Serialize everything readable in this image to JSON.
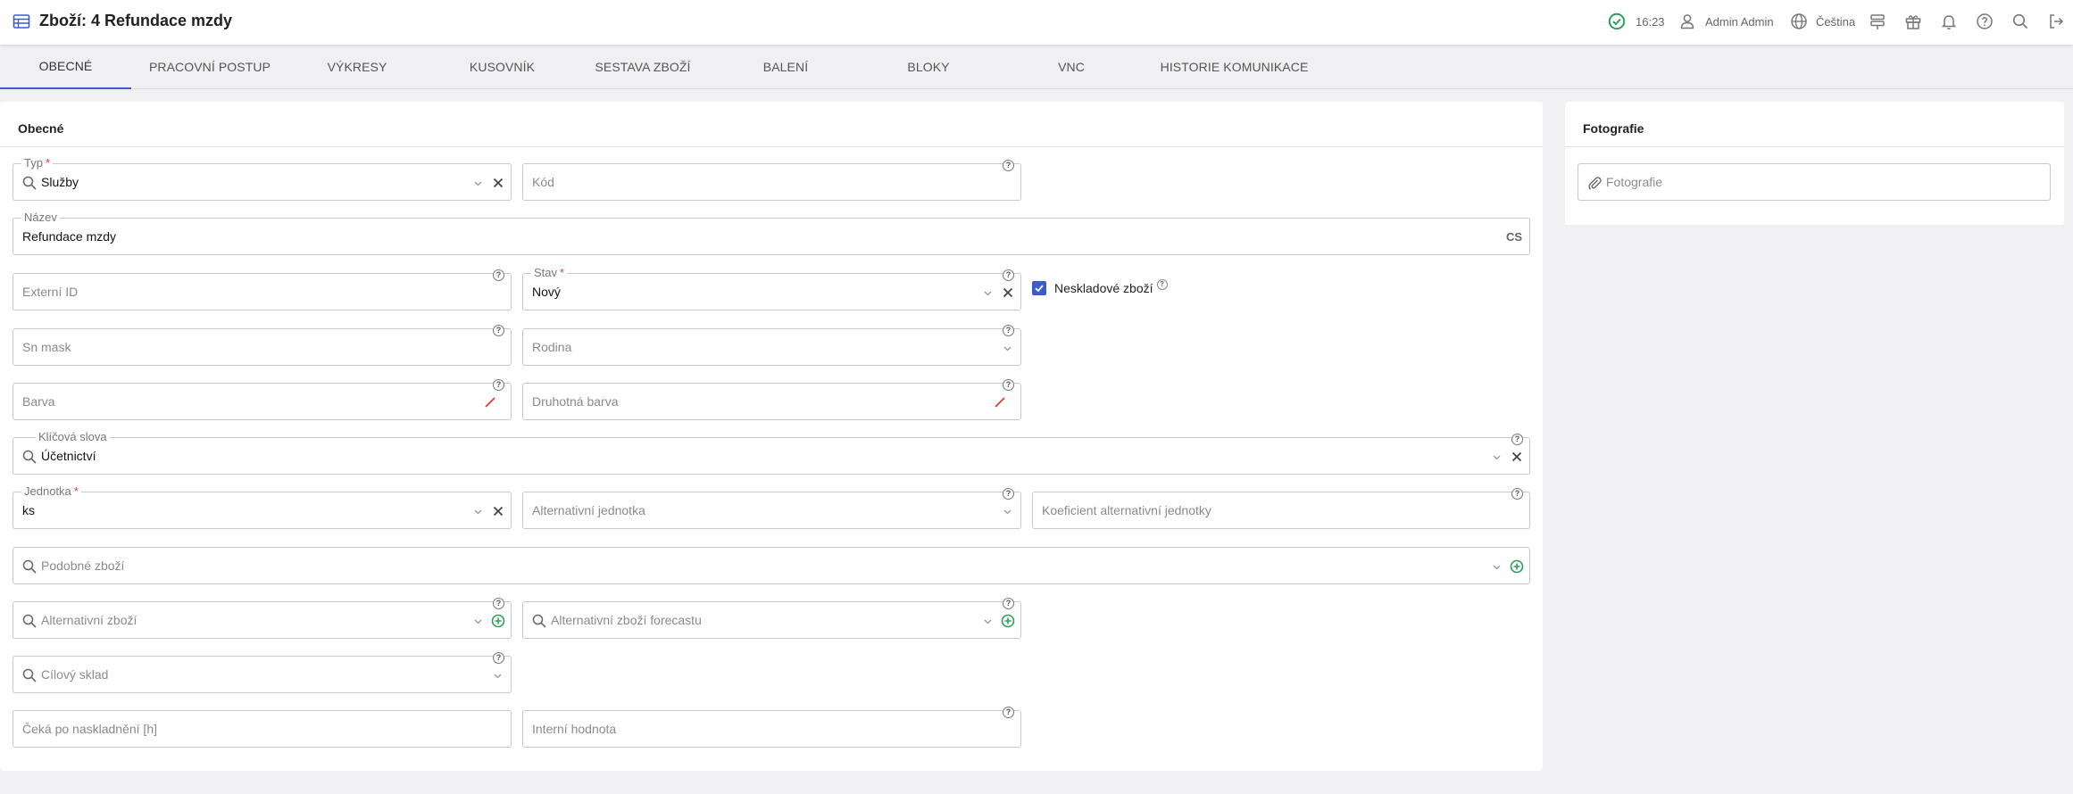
{
  "header": {
    "title": "Zboží: 4 Refundace mzdy",
    "time": "16:23",
    "user": "Admin Admin",
    "language": "Čeština"
  },
  "tabs": [
    {
      "label": "Obecné",
      "active": true
    },
    {
      "label": "Pracovní postup"
    },
    {
      "label": "Výkresy"
    },
    {
      "label": "Kusovník"
    },
    {
      "label": "Sestava zboží"
    },
    {
      "label": "Balení"
    },
    {
      "label": "Bloky"
    },
    {
      "label": "VNC"
    },
    {
      "label": "Historie komunikace"
    }
  ],
  "general": {
    "title": "Obecné",
    "typ": {
      "label": "Typ",
      "value": "Služby"
    },
    "kod": {
      "placeholder": "Kód"
    },
    "nazev": {
      "label": "Název",
      "value": "Refundace mzdy",
      "lang": "CS"
    },
    "externi_id": {
      "placeholder": "Externí ID"
    },
    "stav": {
      "label": "Stav",
      "value": "Nový"
    },
    "neskladove": {
      "label": "Neskladové zboží",
      "checked": true
    },
    "sn_mask": {
      "placeholder": "Sn mask"
    },
    "rodina": {
      "placeholder": "Rodina"
    },
    "barva": {
      "placeholder": "Barva"
    },
    "druhotna_barva": {
      "placeholder": "Druhotná barva"
    },
    "klicova_slova": {
      "label": "Klíčová slova",
      "value": "Účetnictví"
    },
    "jednotka": {
      "label": "Jednotka",
      "value": "ks"
    },
    "alt_jednotka": {
      "placeholder": "Alternativní jednotka"
    },
    "koef_alt_jednotky": {
      "placeholder": "Koeficient alternativní jednotky"
    },
    "podobne_zbozi": {
      "placeholder": "Podobné zboží"
    },
    "alt_zbozi": {
      "placeholder": "Alternativní zboží"
    },
    "alt_zbozi_forecastu": {
      "placeholder": "Alternativní zboží forecastu"
    },
    "cilovy_sklad": {
      "placeholder": "Cílový sklad"
    },
    "ceka_po_naskladneni": {
      "placeholder": "Čeká po naskladnění [h]"
    },
    "interni_hodnota": {
      "placeholder": "Interní hodnota"
    }
  },
  "photos": {
    "title": "Fotografie",
    "placeholder": "Fotografie"
  },
  "colors": {
    "accent": "#3d5bc9",
    "success": "#2e9e5b",
    "required": "#e53935"
  }
}
